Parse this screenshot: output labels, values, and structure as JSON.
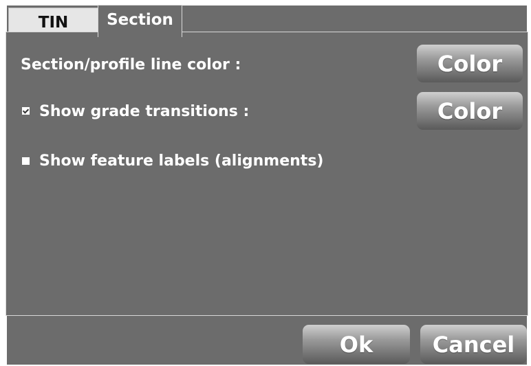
{
  "tabs": [
    {
      "label": "TIN",
      "active": false
    },
    {
      "label": "Section",
      "active": true
    }
  ],
  "section_panel": {
    "line_color_label": "Section/profile line color :",
    "line_color_button": "Color",
    "grade_transitions": {
      "label": "Show grade transitions :",
      "checked": true,
      "color_button": "Color"
    },
    "feature_labels": {
      "label": "Show feature labels (alignments)",
      "checked": false
    }
  },
  "footer": {
    "ok_label": "Ok",
    "cancel_label": "Cancel"
  },
  "colors": {
    "background": "#6c6c6c",
    "inactive_tab": "#e6e6e6",
    "text": "#ffffff"
  }
}
